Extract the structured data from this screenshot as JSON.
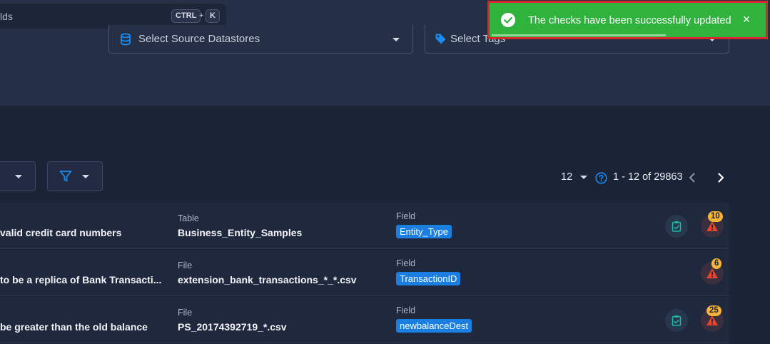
{
  "search": {
    "text": "lds",
    "shortcut_key1": "CTRL",
    "shortcut_plus": "+",
    "shortcut_key2": "K"
  },
  "filters": {
    "source_datastores_placeholder": "Select Source Datastores",
    "tags_placeholder": "Select Tags"
  },
  "toast": {
    "message": "The checks have been successfully updated",
    "close": "×",
    "progress": 0.63
  },
  "pagination": {
    "page_size": "12",
    "range": "1 - 12 of 29863"
  },
  "checks": [
    {
      "name": "valid credit card numbers",
      "target_type": "Table",
      "target": "Business_Entity_Samples",
      "field_label": "Field",
      "field": "Entity_Type",
      "anomaly_count": "10"
    },
    {
      "name": "to be a replica of Bank Transacti...",
      "target_type": "File",
      "target": "extension_bank_transactions_*_*.csv",
      "field_label": "Field",
      "field": "TransactionID",
      "anomaly_count": "6"
    },
    {
      "name": "be greater than the old balance",
      "target_type": "File",
      "target": "PS_20174392719_*.csv",
      "field_label": "Field",
      "field": "newbalanceDest",
      "anomaly_count": "25"
    }
  ],
  "colors": {
    "toast_background": "#2fb33c",
    "toast_highlight_border": "#d62828",
    "field_badge": "#1a7fe0",
    "anomaly_badge": "#f4b43a",
    "warning_icon": "#e8452c",
    "accent": "#1a8cf0"
  },
  "icons": {
    "toast": "check-circle-icon",
    "close": "close-icon",
    "datastore": "database-icon",
    "tags": "tag-icon",
    "filter": "filter-icon",
    "help": "question-circle-icon",
    "prev": "chevron-left-icon",
    "next": "chevron-right-icon",
    "validated": "clipboard-check-icon",
    "anomaly": "warning-icon"
  }
}
